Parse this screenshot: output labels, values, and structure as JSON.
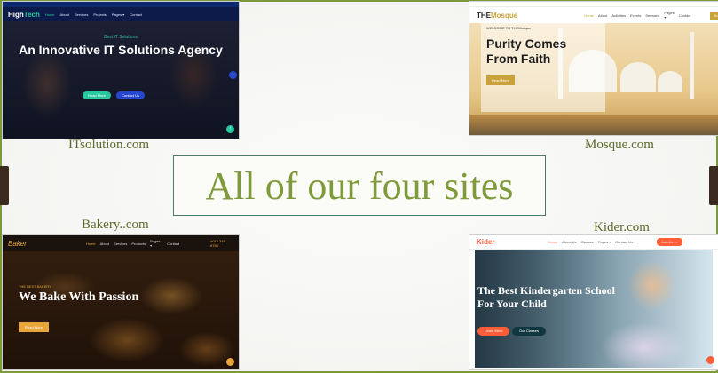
{
  "center_title": "All of our four sites",
  "captions": {
    "itsolution": "ITsolution.com",
    "mosque": "Mosque.com",
    "bakery": "Bakery..com",
    "kider": "Kider.com"
  },
  "hightech": {
    "logo_a": "High",
    "logo_b": "Tech",
    "nav": [
      "Home",
      "About",
      "Services",
      "Projects",
      "Pages ▾",
      "Contact"
    ],
    "kicker": "Best IT Solutions",
    "headline": "An Innovative IT Solutions Agency",
    "read_more": "Read More",
    "contact_us": "Contact Us"
  },
  "mosque": {
    "logo_a": "THE",
    "logo_b": "Mosque",
    "nav": [
      "Home",
      "About",
      "Activities",
      "Events",
      "Sermons",
      "Pages ▾",
      "Contact"
    ],
    "donate": "Donate",
    "welcome": "WELCOME TO THEMosque",
    "headline_1": "Purity Comes",
    "headline_2": "From Faith",
    "read_more": "Read More"
  },
  "bakery": {
    "logo": "Baker",
    "nav": [
      "Home",
      "About",
      "Services",
      "Products",
      "Pages ▾",
      "Contact"
    ],
    "phone": "+012 345 6789",
    "kicker": "THE BEST BAKERY",
    "headline": "We Bake With Passion",
    "read_more": "Read More"
  },
  "kider": {
    "logo": "Kider",
    "nav": [
      "Home",
      "About Us",
      "Classes",
      "Pages ▾",
      "Contact Us"
    ],
    "join": "Join Us →",
    "headline_1": "The Best Kindergarten School",
    "headline_2": "For Your Child",
    "learn_more": "Learn More",
    "our_classes": "Our Classes"
  },
  "colors": {
    "caption": "#5c6a2a",
    "title": "#7f9a3a",
    "hightech_accent": "#27c7a0",
    "mosque_accent": "#c9a23a",
    "bakery_accent": "#e8a53a",
    "kider_accent": "#fe5d37"
  }
}
